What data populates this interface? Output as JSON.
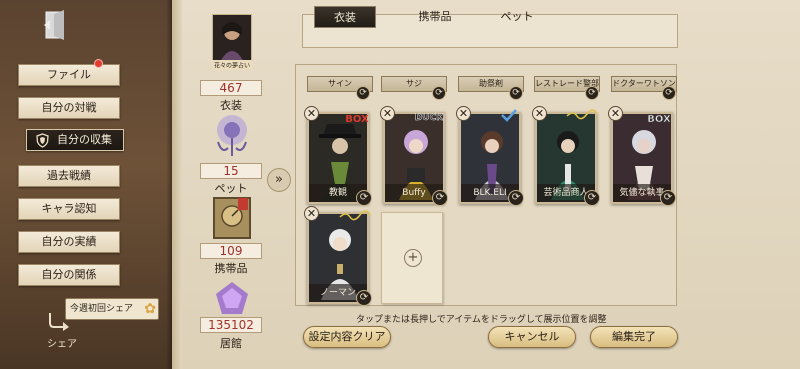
{
  "sidebar": {
    "menu": [
      {
        "label": "ファイル"
      },
      {
        "label": "自分の対戦"
      },
      {
        "label": "自分の収集"
      },
      {
        "label": "過去戦績"
      },
      {
        "label": "キャラ認知"
      },
      {
        "label": "自分の実績"
      },
      {
        "label": "自分の関係"
      }
    ],
    "weekly_share": "今週初回シェア",
    "share_label": "シェア",
    "exit_icon": "exit-door-icon"
  },
  "stats": {
    "costume": {
      "portrait_caption": "花々の夢占い",
      "value": "467",
      "label": "衣装"
    },
    "pet": {
      "value": "15",
      "label": "ペット"
    },
    "item": {
      "value": "109",
      "label": "携帯品"
    },
    "residence": {
      "value": "135102",
      "label": "居館"
    }
  },
  "tabs": [
    {
      "label": "衣装",
      "active": true
    },
    {
      "label": "携帯品",
      "active": false
    },
    {
      "label": "ペット",
      "active": false
    }
  ],
  "top_strips": [
    "サイン",
    "サジ",
    "助祭剤",
    "レストレード警部",
    "ドクターワトソン"
  ],
  "cards": [
    {
      "name": "教観",
      "badge": "BOX",
      "bg": "#2c2a24",
      "accent": "#6a8a3a"
    },
    {
      "name": "Buffy",
      "badge": "DUCK",
      "bg": "#3a2f2a",
      "accent": "#d8b02a"
    },
    {
      "name": "BLK.ELI",
      "badge": "",
      "bg": "#2f3238",
      "accent": "#c9c9d4"
    },
    {
      "name": "芸術品商人",
      "badge": "",
      "bg": "#263630",
      "accent": "#2e8a6a"
    },
    {
      "name": "気儘な執事",
      "badge": "BOX",
      "bg": "#3a2c30",
      "accent": "#7a4a56"
    },
    {
      "name": "ノーマン",
      "badge": "",
      "bg": "#2e3034",
      "accent": "#e6e6e6"
    }
  ],
  "hint": "タップまたは長押しでアイテムをドラッグして展示位置を調整",
  "buttons": {
    "reset": "設定内容クリア",
    "cancel": "キャンセル",
    "done": "編集完了"
  },
  "colors": {
    "value_red": "#a0302a",
    "sidebar_brown": "#6e5238",
    "panel_cream": "#e7ddc8",
    "notification": "#e23c2e"
  }
}
